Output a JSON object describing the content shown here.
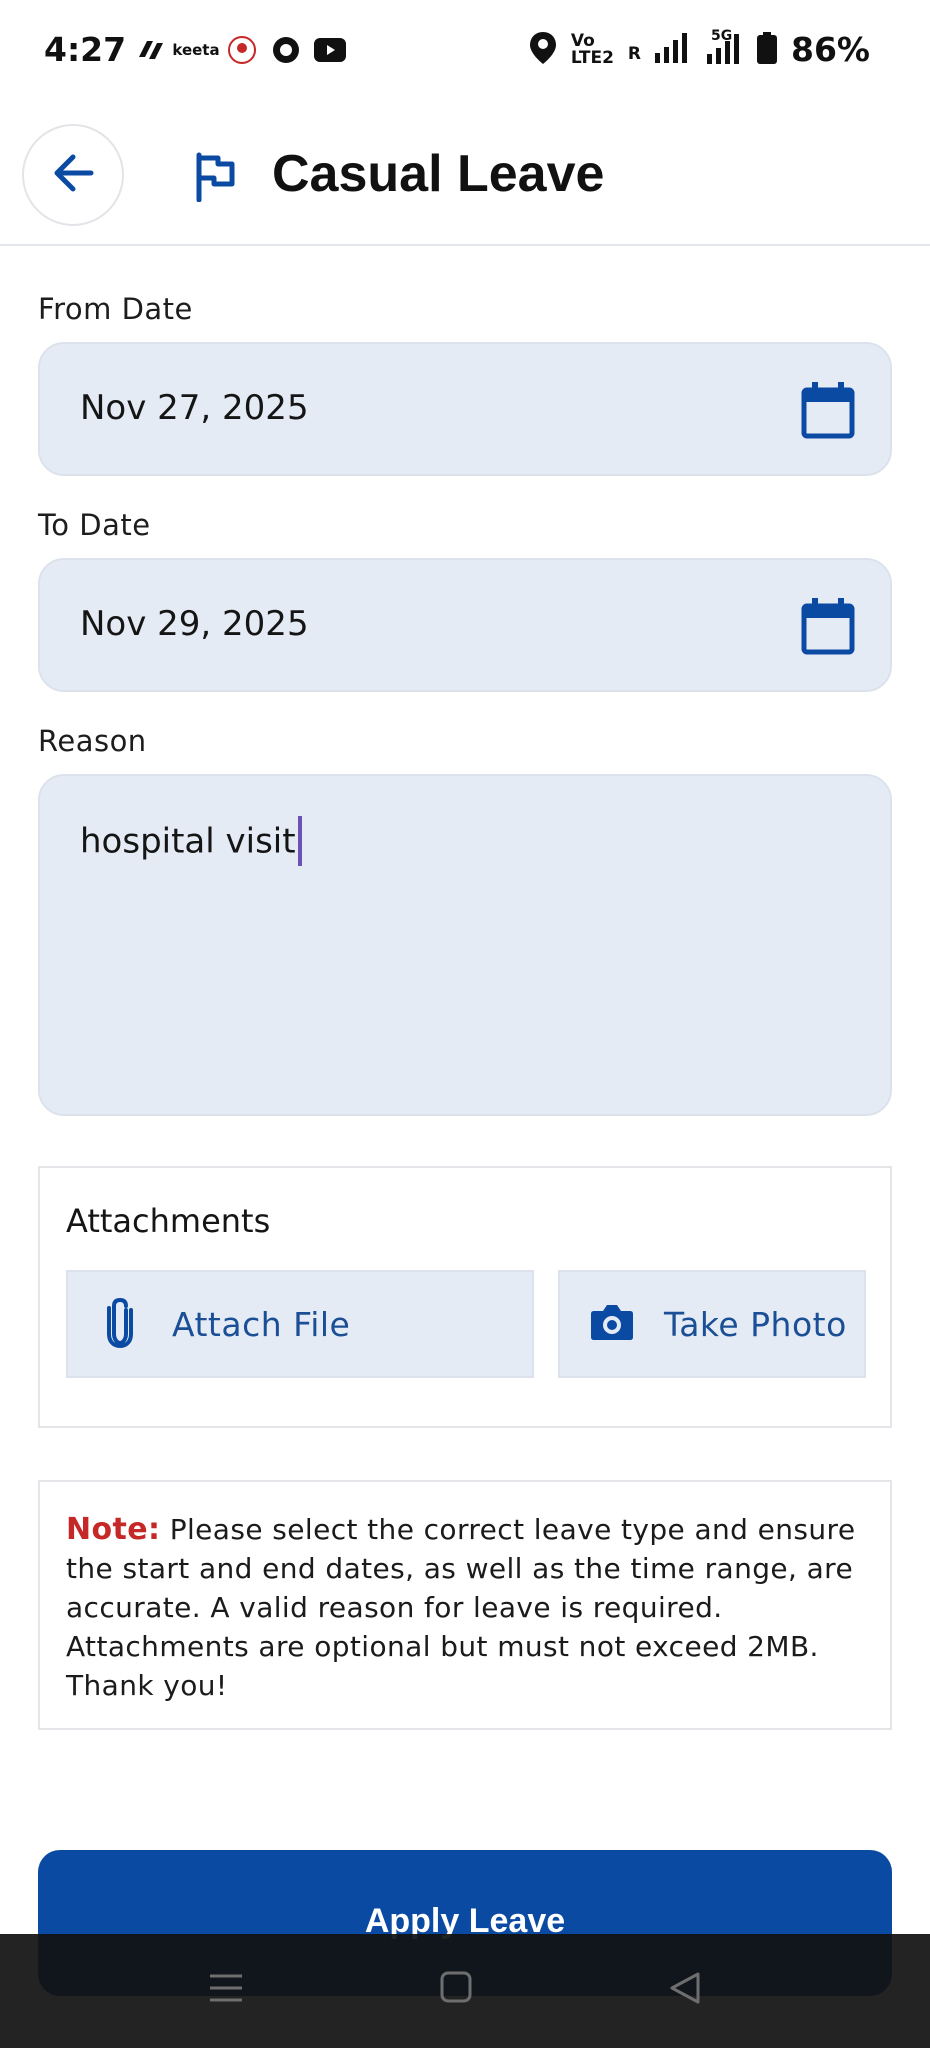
{
  "status_bar": {
    "time": "4:27",
    "app_icons": [
      "app-icon-1",
      "keeta-icon",
      "app-icon-3",
      "app-icon-4",
      "youtube-icon"
    ],
    "keeta_label": "keeta",
    "volte_top": "Vo",
    "volte_bottom": "LTE2",
    "roaming": "R",
    "network": "5G",
    "battery": "86%"
  },
  "header": {
    "title": "Casual Leave"
  },
  "form": {
    "from_date_label": "From Date",
    "from_date_value": "Nov 27, 2025",
    "to_date_label": "To Date",
    "to_date_value": "Nov 29, 2025",
    "reason_label": "Reason",
    "reason_value": "hospital visit"
  },
  "attachments": {
    "title": "Attachments",
    "attach_file_label": "Attach File",
    "take_photo_label": "Take Photo"
  },
  "note": {
    "label": "Note:",
    "text": " Please select the correct leave type and ensure the start and end dates, as well as the time range, are accurate. A valid reason for leave is required. Attachments are optional but must not exceed 2MB. Thank you!"
  },
  "actions": {
    "apply_label": "Apply Leave"
  },
  "colors": {
    "primary": "#0b4aa2",
    "field_bg": "#e4ebf5",
    "note_red": "#c62828",
    "cursor": "#6a52b6"
  }
}
